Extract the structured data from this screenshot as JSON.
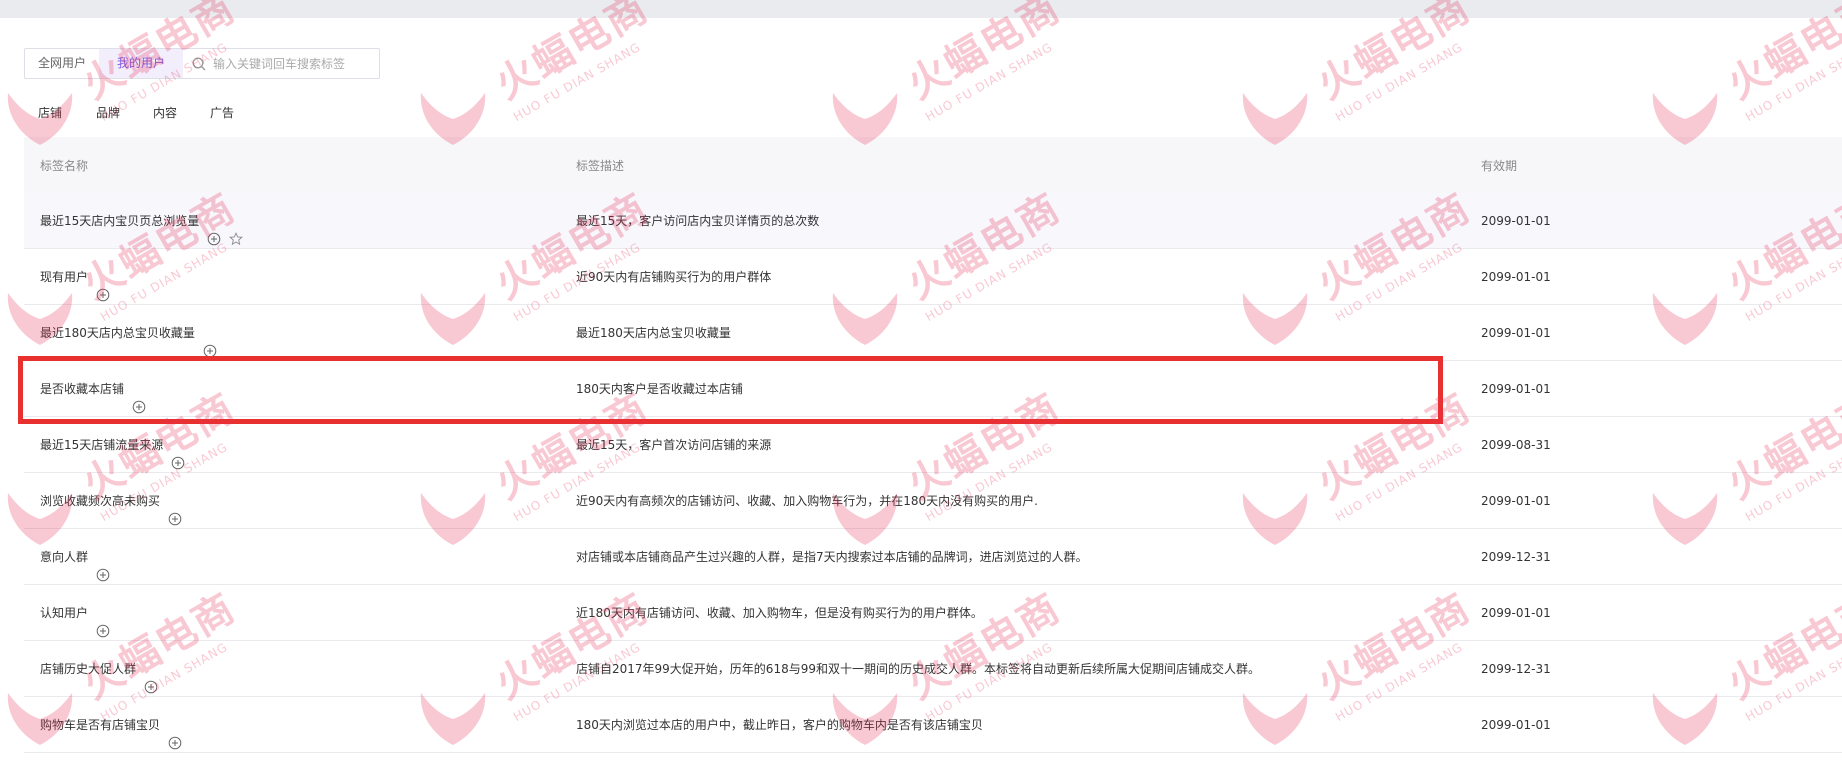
{
  "filter": {
    "scope_all_label": "全网用户",
    "scope_mine_label": "我的用户",
    "search_placeholder": "输入关键词回车搜索标签",
    "search_value": ""
  },
  "category_tabs": [
    "店铺",
    "品牌",
    "内容",
    "广告"
  ],
  "table": {
    "headers": {
      "name": "标签名称",
      "description": "标签描述",
      "validity": "有效期"
    },
    "rows": [
      {
        "name": "最近15天店内宝贝页总浏览量",
        "description": "最近15天，客户访问店内宝贝详情页的总次数",
        "validity": "2099-01-01",
        "starred_icon": true
      },
      {
        "name": "现有用户",
        "description": "近90天内有店铺购买行为的用户群体",
        "validity": "2099-01-01"
      },
      {
        "name": "最近180天店内总宝贝收藏量",
        "description": "最近180天店内总宝贝收藏量",
        "validity": "2099-01-01"
      },
      {
        "name": "是否收藏本店铺",
        "description": "180天内客户是否收藏过本店铺",
        "validity": "2099-01-01",
        "highlighted": true
      },
      {
        "name": "最近15天店铺流量来源",
        "description": "最近15天，客户首次访问店铺的来源",
        "validity": "2099-08-31"
      },
      {
        "name": "浏览收藏频次高未购买",
        "description": "近90天内有高频次的店铺访问、收藏、加入购物车行为，并在180天内没有购买的用户.",
        "validity": "2099-01-01"
      },
      {
        "name": "意向人群",
        "description": "对店铺或本店铺商品产生过兴趣的人群，是指7天内搜索过本店铺的品牌词，进店浏览过的人群。",
        "validity": "2099-12-31"
      },
      {
        "name": "认知用户",
        "description": "近180天内有店铺访问、收藏、加入购物车，但是没有购买行为的用户群体。",
        "validity": "2099-01-01"
      },
      {
        "name": "店铺历史大促人群",
        "description": "店铺自2017年99大促开始，历年的618与99和双十一期间的历史成交人群。本标签将自动更新后续所属大促期间店铺成交人群。",
        "validity": "2099-12-31"
      },
      {
        "name": "购物车是否有店铺宝贝",
        "description": "180天内浏览过本店的用户中，截止昨日，客户的购物车内是否有该店铺宝贝",
        "validity": "2099-01-01"
      }
    ]
  },
  "watermark": {
    "text_cn": "火蝠电商",
    "text_en": "HUO FU DIAN SHANG"
  },
  "colors": {
    "accent": "#7c5ce0",
    "highlight": "#e8302e",
    "watermark": "#e8305a"
  },
  "icons": {
    "search": "search-icon",
    "add": "plus-circle-icon",
    "favorite": "star-outline-icon"
  }
}
